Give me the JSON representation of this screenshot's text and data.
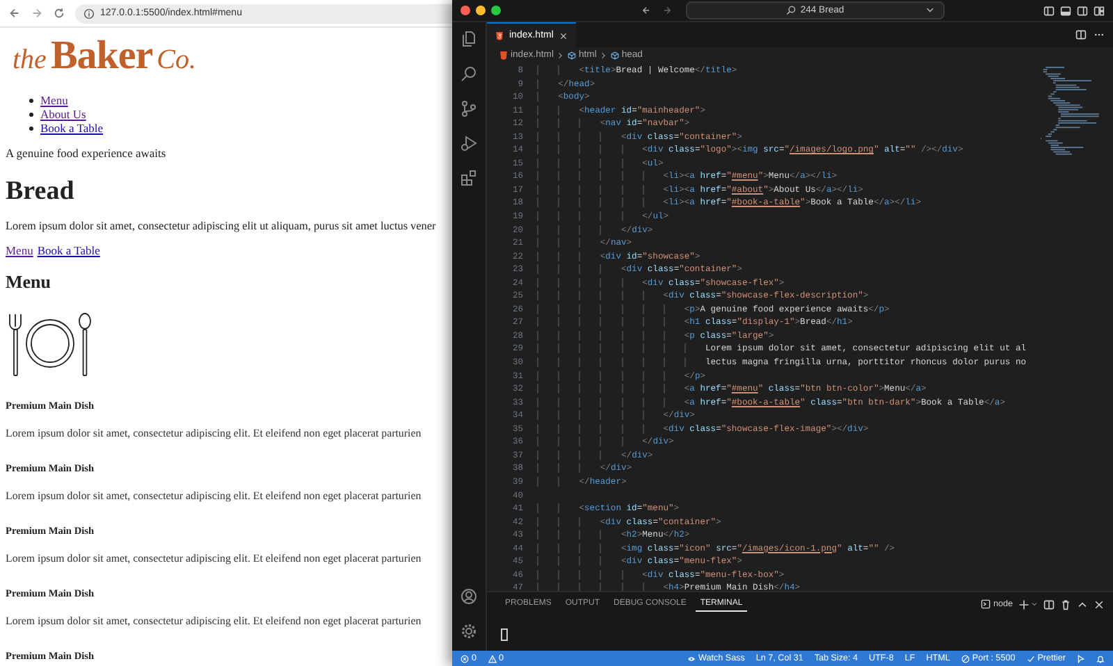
{
  "browser": {
    "url": "127.0.0.1:5500/index.html#menu"
  },
  "page": {
    "logo": {
      "script_left": "the",
      "name": "Baker",
      "script_right": "Co."
    },
    "nav": [
      {
        "label": "Menu",
        "visited": true
      },
      {
        "label": "About Us",
        "visited": true
      },
      {
        "label": "Book a Table",
        "visited": false
      }
    ],
    "tagline": "A genuine food experience awaits",
    "heading": "Bread",
    "intro": "Lorem ipsum dolor sit amet, consectetur adipiscing elit ut aliquam, purus sit amet luctus vener",
    "links": [
      {
        "label": "Menu",
        "visited": true
      },
      {
        "label": "Book a Table",
        "visited": false
      }
    ],
    "section_title": "Menu",
    "dishes": [
      {
        "title": "Premium Main Dish",
        "text": "Lorem ipsum dolor sit amet, consectetur adipiscing elit. Et eleifend non eget placerat parturien"
      },
      {
        "title": "Premium Main Dish",
        "text": "Lorem ipsum dolor sit amet, consectetur adipiscing elit. Et eleifend non eget placerat parturien"
      },
      {
        "title": "Premium Main Dish",
        "text": "Lorem ipsum dolor sit amet, consectetur adipiscing elit. Et eleifend non eget placerat parturien"
      },
      {
        "title": "Premium Main Dish",
        "text": "Lorem ipsum dolor sit amet, consectetur adipiscing elit. Et eleifend non eget placerat parturien"
      },
      {
        "title": "Premium Main Dish"
      }
    ]
  },
  "editor": {
    "command_center": "244 Bread",
    "tabs": [
      {
        "label": "index.html",
        "selected": true
      }
    ],
    "breadcrumbs": [
      {
        "label": "index.html",
        "kind": "file"
      },
      {
        "label": "html",
        "kind": "element"
      },
      {
        "label": "head",
        "kind": "element"
      }
    ],
    "lines": [
      {
        "number": "8",
        "code": "        <title>Bread | Welcome</title>"
      },
      {
        "number": "9",
        "code": "    </head>"
      },
      {
        "number": "10",
        "code": "    <body>"
      },
      {
        "number": "11",
        "code": "        <header id=\"mainheader\">"
      },
      {
        "number": "12",
        "code": "            <nav id=\"navbar\">"
      },
      {
        "number": "13",
        "code": "                <div class=\"container\">"
      },
      {
        "number": "14",
        "code": "                    <div class=\"logo\"><img src=\"/images/logo.png\" alt=\"\" /></div>"
      },
      {
        "number": "15",
        "code": "                    <ul>"
      },
      {
        "number": "16",
        "code": "                        <li><a href=\"#menu\">Menu</a></li>"
      },
      {
        "number": "17",
        "code": "                        <li><a href=\"#about\">About Us</a></li>"
      },
      {
        "number": "18",
        "code": "                        <li><a href=\"#book-a-table\">Book a Table</a></li>"
      },
      {
        "number": "19",
        "code": "                    </ul>"
      },
      {
        "number": "20",
        "code": "                </div>"
      },
      {
        "number": "21",
        "code": "            </nav>"
      },
      {
        "number": "22",
        "code": "            <div id=\"showcase\">"
      },
      {
        "number": "23",
        "code": "                <div class=\"container\">"
      },
      {
        "number": "24",
        "code": "                    <div class=\"showcase-flex\">"
      },
      {
        "number": "25",
        "code": "                        <div class=\"showcase-flex-description\">"
      },
      {
        "number": "26",
        "code": "                            <p>A genuine food experience awaits</p>"
      },
      {
        "number": "27",
        "code": "                            <h1 class=\"display-1\">Bread</h1>"
      },
      {
        "number": "28",
        "code": "                            <p class=\"large\">"
      },
      {
        "number": "29",
        "code": "                                Lorem ipsum dolor sit amet, consectetur adipiscing elit ut al"
      },
      {
        "number": "30",
        "code": "                                lectus magna fringilla urna, porttitor rhoncus dolor purus no"
      },
      {
        "number": "31",
        "code": "                            </p>"
      },
      {
        "number": "32",
        "code": "                            <a href=\"#menu\" class=\"btn btn-color\">Menu</a>"
      },
      {
        "number": "33",
        "code": "                            <a href=\"#book-a-table\" class=\"btn btn-dark\">Book a Table</a>"
      },
      {
        "number": "34",
        "code": "                        </div>"
      },
      {
        "number": "35",
        "code": "                        <div class=\"showcase-flex-image\"></div>"
      },
      {
        "number": "36",
        "code": "                    </div>"
      },
      {
        "number": "37",
        "code": "                </div>"
      },
      {
        "number": "38",
        "code": "            </div>"
      },
      {
        "number": "39",
        "code": "        </header>"
      },
      {
        "number": "40"
      },
      {
        "number": "41",
        "code": "        <section id=\"menu\">"
      },
      {
        "number": "42",
        "code": "            <div class=\"container\">"
      },
      {
        "number": "43",
        "code": "                <h2>Menu</h2>"
      },
      {
        "number": "44",
        "code": "                <img class=\"icon\" src=\"/images/icon-1.png\" alt=\"\" />"
      },
      {
        "number": "45",
        "code": "                <div class=\"menu-flex\">"
      },
      {
        "number": "46",
        "code": "                    <div class=\"menu-flex-box\">"
      },
      {
        "number": "47",
        "code": "                        <h4>Premium Main Dish</h4>"
      }
    ],
    "panel": {
      "tabs": [
        {
          "label": "PROBLEMS",
          "selected": false
        },
        {
          "label": "OUTPUT",
          "selected": false
        },
        {
          "label": "DEBUG CONSOLE",
          "selected": false
        },
        {
          "label": "TERMINAL",
          "selected": true
        }
      ],
      "terminal_profile": "node"
    },
    "status_bar": {
      "errors": "0",
      "warnings": "0",
      "items": [
        {
          "label": "Watch Sass",
          "kind": "watch"
        },
        {
          "label": "Ln 7, Col 31",
          "kind": "plain"
        },
        {
          "label": "Tab Size: 4",
          "kind": "plain"
        },
        {
          "label": "UTF-8",
          "kind": "plain"
        },
        {
          "label": "LF",
          "kind": "plain"
        },
        {
          "label": "HTML",
          "kind": "plain"
        },
        {
          "label": "Port : 5500",
          "kind": "port"
        },
        {
          "label": "Prettier",
          "kind": "check"
        }
      ]
    }
  }
}
